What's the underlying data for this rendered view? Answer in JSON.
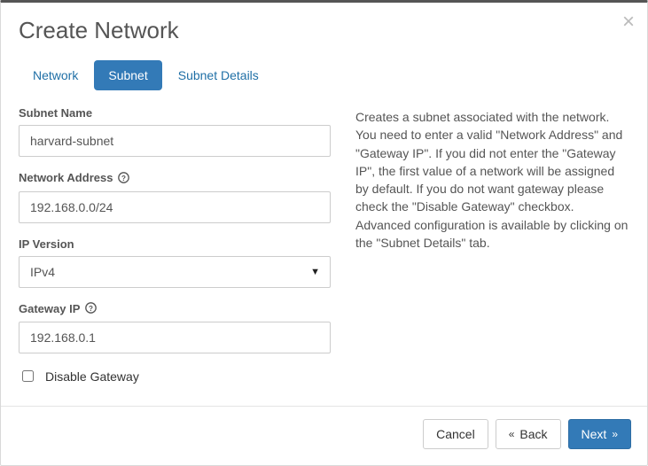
{
  "header": {
    "title": "Create Network"
  },
  "tabs": {
    "network": "Network",
    "subnet": "Subnet",
    "details": "Subnet Details"
  },
  "form": {
    "subnet_name_label": "Subnet Name",
    "subnet_name_value": "harvard-subnet",
    "network_address_label": "Network Address",
    "network_address_value": "192.168.0.0/24",
    "ip_version_label": "IP Version",
    "ip_version_value": "IPv4",
    "gateway_ip_label": "Gateway IP",
    "gateway_ip_value": "192.168.0.1",
    "disable_gateway_label": "Disable Gateway"
  },
  "help_text": "Creates a subnet associated with the network. You need to enter a valid \"Network Address\" and \"Gateway IP\". If you did not enter the \"Gateway IP\", the first value of a network will be assigned by default. If you do not want gateway please check the \"Disable Gateway\" checkbox. Advanced configuration is available by clicking on the \"Subnet Details\" tab.",
  "footer": {
    "cancel": "Cancel",
    "back": "Back",
    "next": "Next"
  }
}
